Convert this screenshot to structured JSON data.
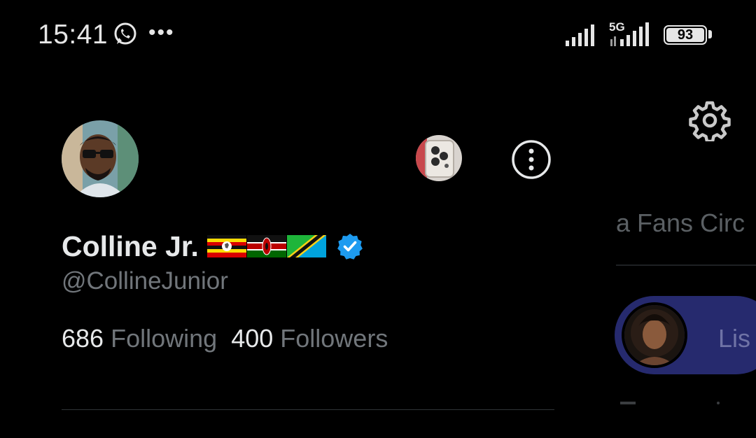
{
  "status_bar": {
    "time": "15:41",
    "network": "5G",
    "battery": "93",
    "icons": [
      "whatsapp-icon",
      "more-notifications-icon",
      "signal-icon",
      "5g-signal-icon",
      "battery-icon"
    ]
  },
  "drawer": {
    "profile": {
      "display_name": "Colline Jr.",
      "flags": [
        "uganda-flag-icon",
        "kenya-flag-icon",
        "tanzania-flag-icon"
      ],
      "verified": true,
      "handle": "@CollineJunior",
      "following_count": "686",
      "following_label": "Following",
      "followers_count": "400",
      "followers_label": "Followers"
    }
  },
  "background": {
    "circle_text": "a Fans Circ",
    "listen_text": "Lis"
  },
  "colors": {
    "background": "#000000",
    "primary_text": "#e7e9ea",
    "secondary_text": "#71767b",
    "verified_blue": "#1d9bf0",
    "listen_pill": "#262a6e"
  }
}
